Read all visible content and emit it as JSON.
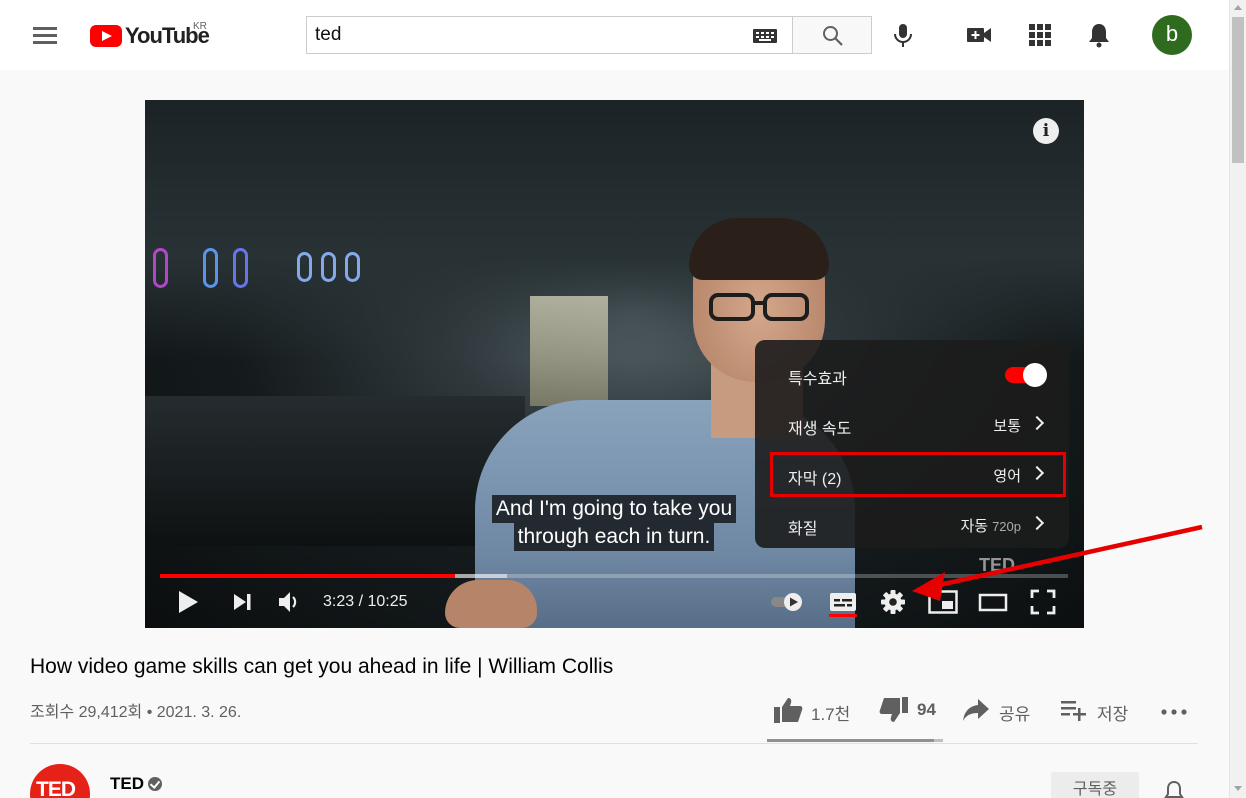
{
  "header": {
    "logo_text": "YouTube",
    "country_code": "KR",
    "search_value": "ted",
    "avatar_letter": "b"
  },
  "player": {
    "caption_lines": [
      "And I'm going to take you",
      "through each in turn."
    ],
    "current_time": "3:23",
    "duration": "10:25",
    "time_display": "3:23 / 10:25",
    "played_fraction": 0.325,
    "buffered_fraction": 0.382,
    "watermark": "TED",
    "settings_menu": [
      {
        "label": "특수효과",
        "value": "",
        "type": "toggle",
        "on": true
      },
      {
        "label": "재생 속도",
        "value": "보통",
        "type": "submenu"
      },
      {
        "label": "자막 (2)",
        "value": "영어",
        "type": "submenu",
        "highlighted": true
      },
      {
        "label": "화질",
        "value": "자동",
        "value_detail": "720p",
        "type": "submenu"
      }
    ]
  },
  "video": {
    "title": "How video game skills can get you ahead in life | William Collis",
    "meta": "조회수 29,412회 • 2021. 3. 26.",
    "likes": "1.7천",
    "dislikes": "94",
    "share_label": "공유",
    "save_label": "저장",
    "like_ratio": 0.95
  },
  "channel": {
    "name": "TED",
    "avatar_text": "TED",
    "subscribe_label": "구독중"
  },
  "colors": {
    "brand_red": "#ff0000",
    "annotation_red": "#e60000",
    "avatar_green": "#2e6b1f"
  }
}
